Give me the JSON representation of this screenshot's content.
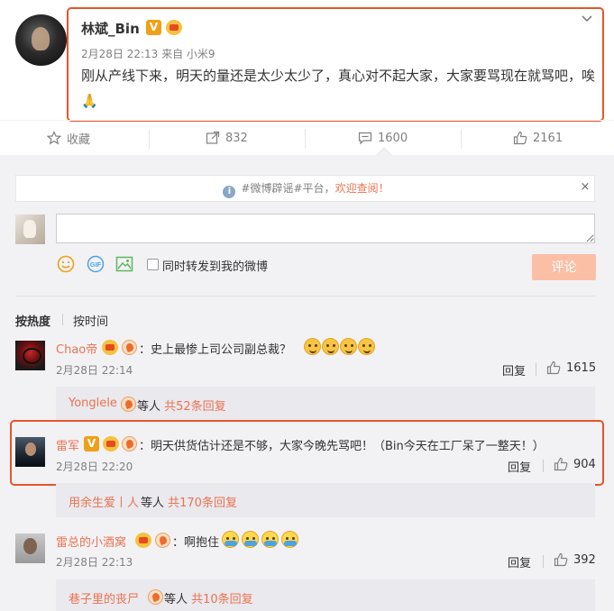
{
  "post": {
    "author": "林斌_Bin",
    "verified_mark": "V",
    "meta": "2月28日 22:13 来自 小米9",
    "text": "刚从产线下来，明天的量还是太少太少了，真心对不起大家，大家要骂现在就骂吧，唉🙏"
  },
  "actions": {
    "favorite_label": "收藏",
    "repost_count": "832",
    "comment_count": "1600",
    "like_count": "2161"
  },
  "notice": {
    "hashtag": "#微博辟谣#",
    "text": "平台，",
    "link": "欢迎查阅！",
    "close": "×"
  },
  "composer": {
    "repost_label": "同时转发到我的微博",
    "submit_label": "评论"
  },
  "sort": {
    "hot_label": "按热度",
    "time_label": "按时间"
  },
  "comments": [
    {
      "name": "Chao帝",
      "text": "：史上最惨上司公司副总裁？",
      "time": "2月28日 22:14",
      "reply_label": "回复",
      "likes": "1615",
      "sub_name": "Yonglele",
      "sub_text": " 等人 ",
      "sub_count": "共52条回复"
    },
    {
      "name": "雷军",
      "verified_mark": "V",
      "text": "：明天供货估计还是不够，大家今晚先骂吧！（Bin今天在工厂呆了一整天！）",
      "time": "2月28日 22:20",
      "reply_label": "回复",
      "likes": "904",
      "sub_name": "用余生爱丨人",
      "sub_text": " 等人 ",
      "sub_count": "共170条回复"
    },
    {
      "name": "雷总的小酒窝",
      "text": "：啊抱住",
      "time": "2月28日 22:13",
      "reply_label": "回复",
      "likes": "392",
      "sub_name": "巷子里的丧尸",
      "sub_text": " 等人 ",
      "sub_count": "共10条回复"
    }
  ],
  "colors": {
    "highlight": "#e8542b",
    "link": "#eb7350",
    "muted": "#808080",
    "comment_bg": "#f2f2f5"
  }
}
